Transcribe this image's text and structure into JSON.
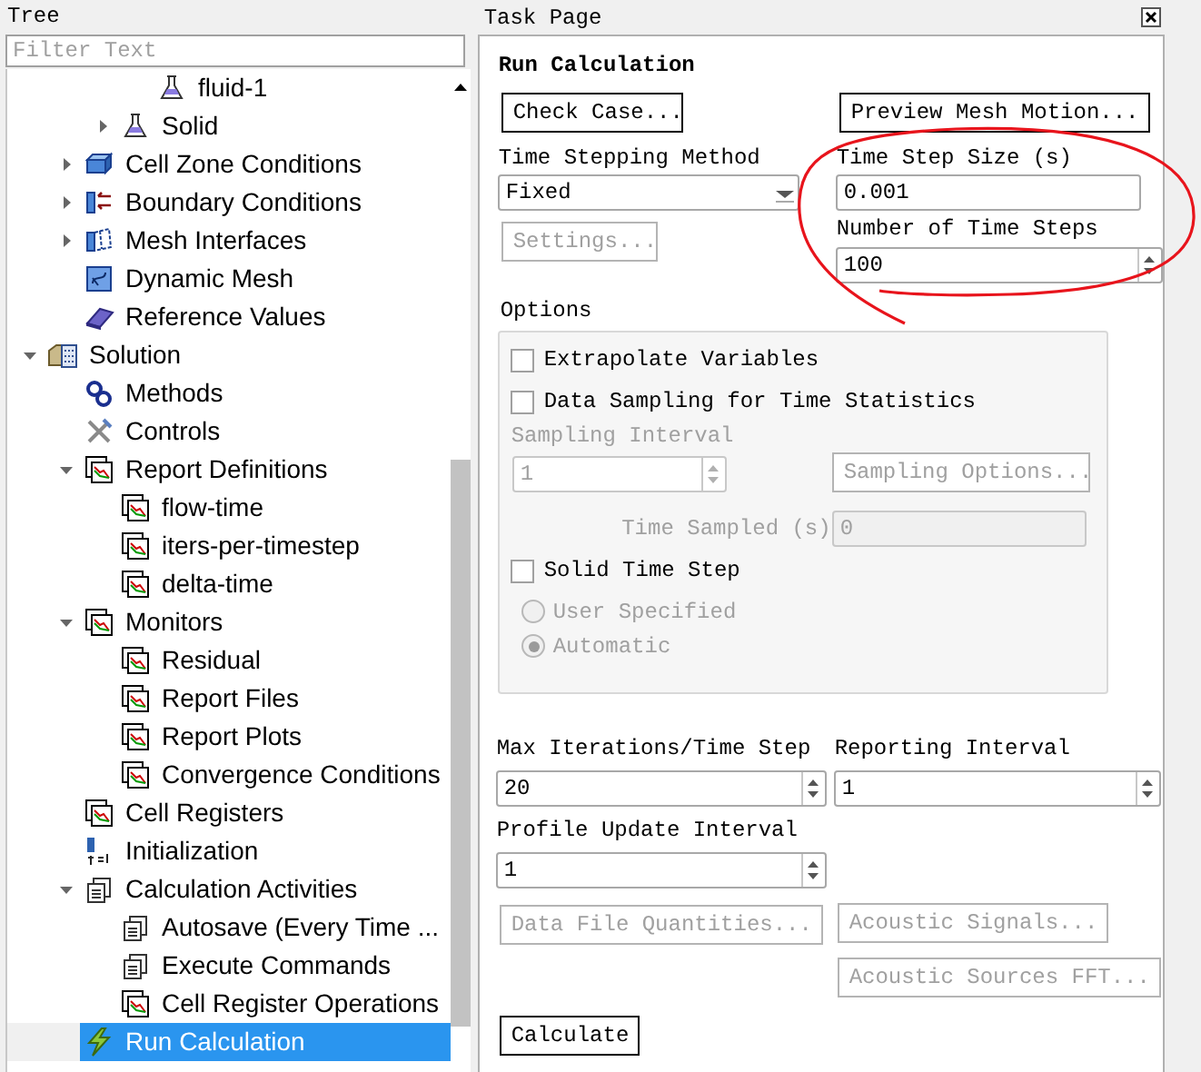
{
  "tree": {
    "title": "Tree",
    "filter": {
      "placeholder": "Filter Text"
    },
    "items": [
      {
        "children": [
          {
            "children": [
              {
                "children": [
                  {
                    "label": "fluid-1",
                    "kind": "flask",
                    "selected": false
                  }
                ]
              },
              {
                "label": "Solid",
                "kind": "flask",
                "expanded": false,
                "selected": false
              }
            ]
          },
          {
            "label": "Cell Zone Conditions",
            "kind": "cube",
            "expanded": false,
            "selected": false
          },
          {
            "label": "Boundary Conditions",
            "kind": "boundary",
            "expanded": false,
            "selected": false
          },
          {
            "label": "Mesh Interfaces",
            "kind": "mesh",
            "expanded": false,
            "selected": false
          },
          {
            "label": "Dynamic Mesh",
            "kind": "dynamic",
            "selected": false
          },
          {
            "label": "Reference Values",
            "kind": "book",
            "selected": false
          }
        ]
      },
      {
        "label": "Solution",
        "kind": "solution",
        "expanded": true,
        "selected": false,
        "children": [
          {
            "label": "Methods",
            "kind": "gears",
            "selected": false
          },
          {
            "label": "Controls",
            "kind": "tools",
            "selected": false
          },
          {
            "label": "Report Definitions",
            "kind": "report",
            "expanded": true,
            "selected": false,
            "children": [
              {
                "label": "flow-time",
                "kind": "report",
                "selected": false
              },
              {
                "label": "iters-per-timestep",
                "kind": "report",
                "selected": false
              },
              {
                "label": "delta-time",
                "kind": "report",
                "selected": false
              }
            ]
          },
          {
            "label": "Monitors",
            "kind": "report",
            "expanded": true,
            "selected": false,
            "children": [
              {
                "label": "Residual",
                "kind": "report",
                "selected": false
              },
              {
                "label": "Report Files",
                "kind": "report",
                "selected": false
              },
              {
                "label": "Report Plots",
                "kind": "report",
                "selected": false
              },
              {
                "label": "Convergence Conditions",
                "kind": "report",
                "selected": false
              }
            ]
          },
          {
            "label": "Cell Registers",
            "kind": "report",
            "selected": false
          },
          {
            "label": "Initialization",
            "kind": "init",
            "selected": false
          },
          {
            "label": "Calculation Activities",
            "kind": "doc",
            "expanded": true,
            "selected": false,
            "children": [
              {
                "label": "Autosave (Every Time ...",
                "kind": "doc",
                "selected": false
              },
              {
                "label": "Execute Commands",
                "kind": "doc",
                "selected": false
              },
              {
                "label": "Cell Register Operations",
                "kind": "report",
                "selected": false
              }
            ]
          },
          {
            "label": "Run Calculation",
            "kind": "bolt",
            "selected": true
          }
        ]
      }
    ]
  },
  "task_page": {
    "title": "Task Page",
    "heading": "Run Calculation",
    "check_case_button": {
      "label": "Check Case...",
      "disabled": false
    },
    "preview_mesh_motion_button": {
      "label": "Preview Mesh Motion...",
      "disabled": false
    },
    "time_stepping_method": {
      "label": "Time Stepping Method",
      "value": "Fixed"
    },
    "time_step_size": {
      "label": "Time Step Size (s)",
      "value": "0.001"
    },
    "settings_button": {
      "label": "Settings...",
      "disabled": true
    },
    "number_of_time_steps": {
      "label": "Number of Time Steps",
      "value": "100"
    },
    "options": {
      "title": "Options",
      "extrapolate_variables": {
        "label": "Extrapolate Variables",
        "checked": false
      },
      "data_sampling": {
        "label": "Data Sampling for Time Statistics",
        "checked": false
      },
      "sampling_interval": {
        "label": "Sampling Interval",
        "value": "1",
        "disabled": true
      },
      "sampling_options_button": {
        "label": "Sampling Options...",
        "disabled": true
      },
      "time_sampled": {
        "label": "Time Sampled (s)",
        "value": "0",
        "disabled": true
      },
      "solid_time_step": {
        "label": "Solid Time Step",
        "checked": false
      },
      "radios": [
        {
          "label": "User Specified",
          "selected": false,
          "disabled": true
        },
        {
          "label": "Automatic",
          "selected": true,
          "disabled": true
        }
      ]
    },
    "max_iterations": {
      "label": "Max Iterations/Time Step",
      "value": "20"
    },
    "reporting_interval": {
      "label": "Reporting Interval",
      "value": "1"
    },
    "profile_update_interval": {
      "label": "Profile Update Interval",
      "value": "1"
    },
    "data_file_quantities_button": {
      "label": "Data File Quantities...",
      "disabled": true
    },
    "acoustic_signals_button": {
      "label": "Acoustic Signals...",
      "disabled": true
    },
    "acoustic_sources_fft_button": {
      "label": "Acoustic Sources FFT...",
      "disabled": true
    },
    "calculate_button": {
      "label": "Calculate",
      "disabled": false
    }
  }
}
